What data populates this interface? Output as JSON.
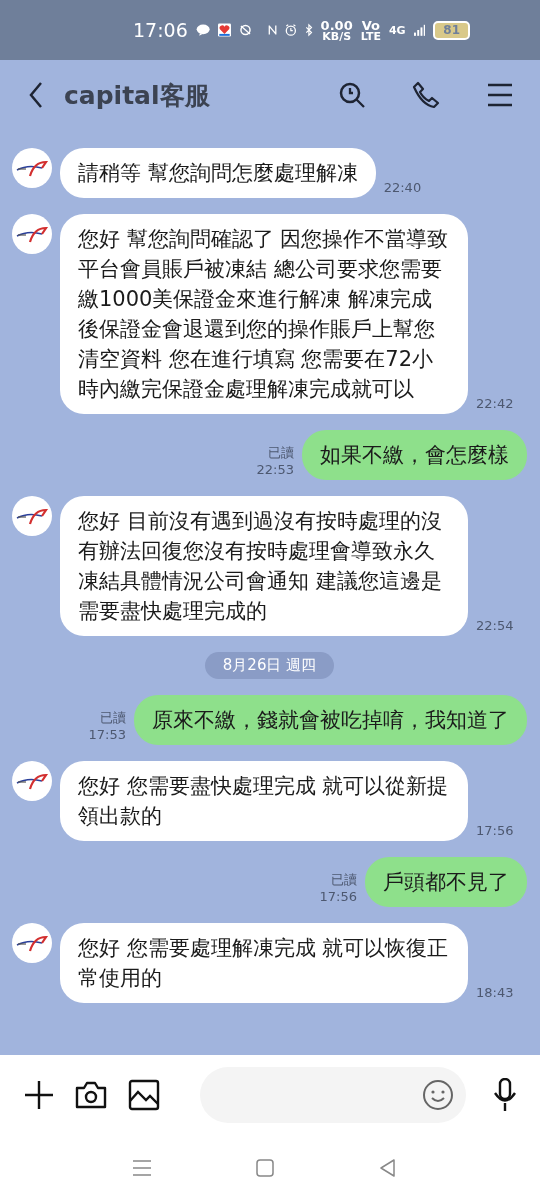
{
  "status_bar": {
    "time": "17:06",
    "network_speed": "0.00",
    "speed_unit": "KB/S",
    "volte_top": "Vo",
    "volte_bottom": "LTE",
    "network_type": "4G",
    "battery": "81"
  },
  "header": {
    "title": "capital客服"
  },
  "messages": [
    {
      "kind": "incoming",
      "text": "請稍等 幫您詢問怎麼處理解凍",
      "time": "22:40"
    },
    {
      "kind": "incoming",
      "text": "您好 幫您詢問確認了 因您操作不當導致平台會員賬戶被凍結 總公司要求您需要繳1000美保證金來進行解凍 解凍完成後保證金會退還到您的操作賬戶上幫您清空資料 您在進行填寫 您需要在72小時內繳完保證金處理解凍完成就可以",
      "time": "22:42"
    },
    {
      "kind": "outgoing",
      "text": "如果不繳，會怎麼樣",
      "read": "已讀",
      "time": "22:53"
    },
    {
      "kind": "incoming",
      "text": "您好 目前沒有遇到過沒有按時處理的沒有辦法回復您沒有按時處理會導致永久凍結具體情況公司會通知 建議您這邊是需要盡快處理完成的",
      "time": "22:54"
    },
    {
      "kind": "date",
      "text": "8月26日 週四"
    },
    {
      "kind": "outgoing",
      "text": "原來不繳，錢就會被吃掉唷，我知道了",
      "read": "已讀",
      "time": "17:53"
    },
    {
      "kind": "incoming",
      "text": "您好 您需要盡快處理完成 就可以從新提領出款的",
      "time": "17:56"
    },
    {
      "kind": "outgoing",
      "text": "戶頭都不見了",
      "read": "已讀",
      "time": "17:56"
    },
    {
      "kind": "incoming",
      "text": "您好 您需要處理解凍完成 就可以恢復正常使用的",
      "time": "18:43"
    }
  ]
}
